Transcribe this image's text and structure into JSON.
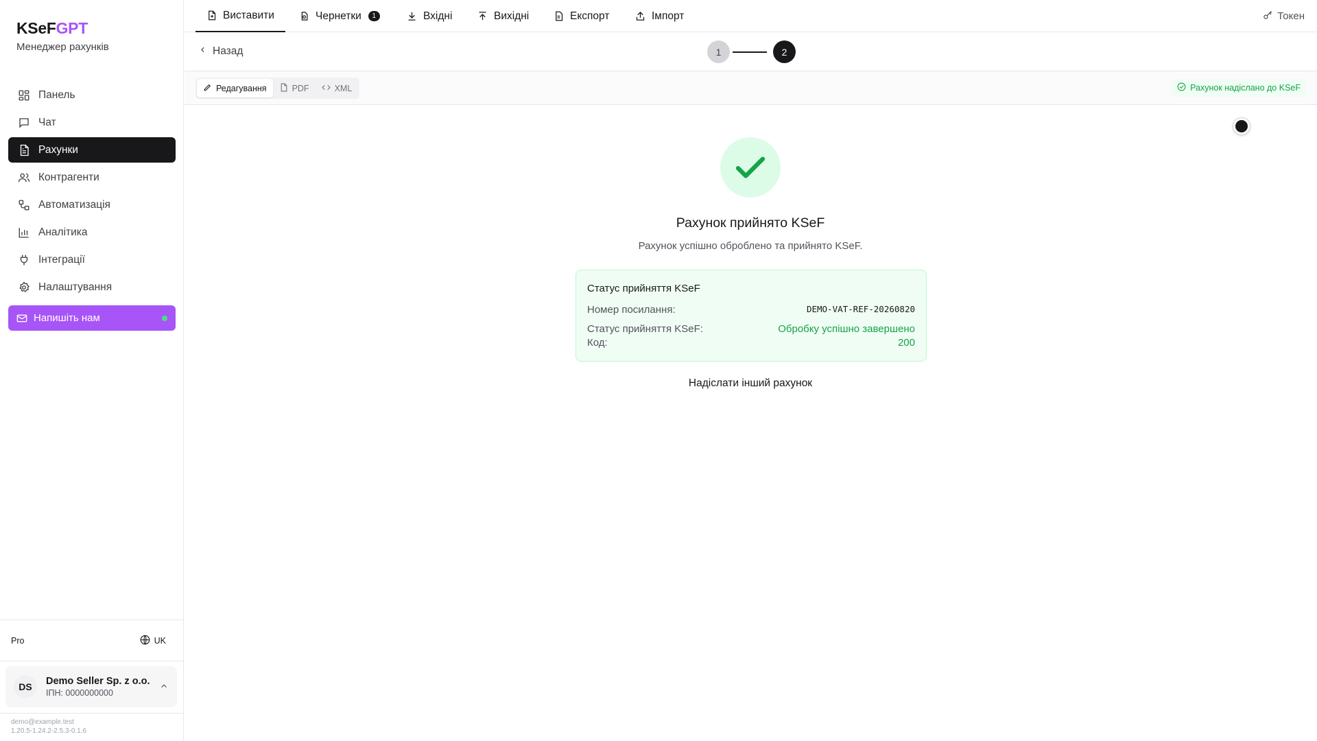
{
  "brand": {
    "name_main": "KSeF",
    "name_accent": "GPT",
    "subtitle": "Менеджер рахунків"
  },
  "sidebar": {
    "items": [
      {
        "label": "Панель",
        "icon": "dashboard-icon"
      },
      {
        "label": "Чат",
        "icon": "chat-icon"
      },
      {
        "label": "Рахунки",
        "icon": "invoice-icon",
        "active": true
      },
      {
        "label": "Контрагенти",
        "icon": "users-icon"
      },
      {
        "label": "Автоматизація",
        "icon": "workflow-icon"
      },
      {
        "label": "Аналітика",
        "icon": "chart-icon"
      },
      {
        "label": "Інтеграції",
        "icon": "plug-icon"
      },
      {
        "label": "Налаштування",
        "icon": "gear-icon"
      }
    ],
    "contact_label": "Напишіть нам",
    "plan": "Pro",
    "language": "UK",
    "user": {
      "initials": "DS",
      "name": "Demo Seller Sp. z o.o.",
      "tax_id": "ІПН: 0000000000"
    },
    "email": "demo@example.test",
    "version": "1.20.5-1.24.2-2.5.3-0.1.6"
  },
  "tabs": [
    {
      "label": "Виставити",
      "icon": "file-plus-icon",
      "active": true
    },
    {
      "label": "Чернетки",
      "icon": "draft-icon",
      "badge": "1"
    },
    {
      "label": "Вхідні",
      "icon": "download-icon"
    },
    {
      "label": "Вихідні",
      "icon": "upload-icon"
    },
    {
      "label": "Експорт",
      "icon": "export-icon"
    },
    {
      "label": "Імпорт",
      "icon": "import-icon"
    }
  ],
  "token_label": "Токен",
  "back_label": "Назад",
  "steps": [
    "1",
    "2"
  ],
  "view_modes": [
    "Редагування",
    "PDF",
    "XML"
  ],
  "sent_badge": "Рахунок надіслано до KSeF",
  "result": {
    "title": "Рахунок прийнято KSeF",
    "subtitle": "Рахунок успішно оброблено та прийнято KSeF.",
    "card_title": "Статус прийняття KSeF",
    "ref_label": "Номер посилання:",
    "ref_value": "DEMO-VAT-REF-20260820",
    "status_label": "Статус прийняття KSeF:",
    "status_value": "Обробку успішно завершено",
    "code_label": "Код:",
    "code_value": "200",
    "resend_label": "Надіслати інший рахунок"
  },
  "colors": {
    "accent": "#a855f7",
    "success": "#16a34a",
    "success_bg": "#dcfce7",
    "dark": "#18181b"
  }
}
